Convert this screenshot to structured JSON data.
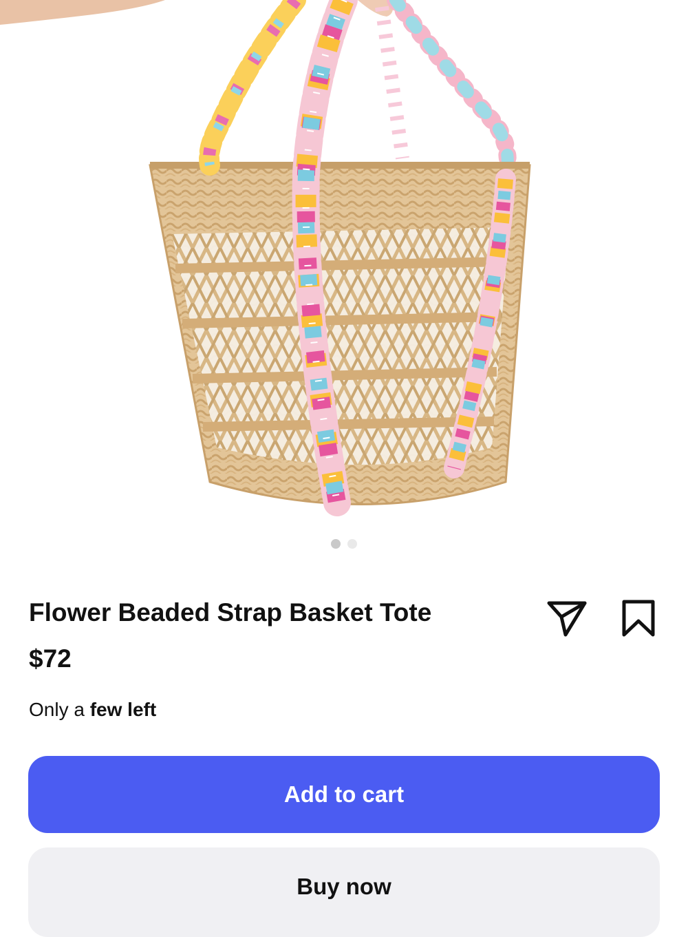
{
  "product": {
    "title": "Flower Beaded Strap Basket Tote",
    "price": "$72",
    "stock_prefix": "Only a",
    "stock_emphasis": "few left",
    "image_alt": "woven basket tote with colorful flower bead straps"
  },
  "gallery": {
    "total_images": 2,
    "active_index": 0
  },
  "actions": {
    "share_icon": "send-icon",
    "save_icon": "bookmark-icon",
    "add_to_cart_label": "Add to cart",
    "buy_now_label": "Buy now"
  },
  "colors": {
    "primary_button": "#4b5cf2",
    "secondary_button": "#f0f0f3",
    "text": "#111111"
  }
}
